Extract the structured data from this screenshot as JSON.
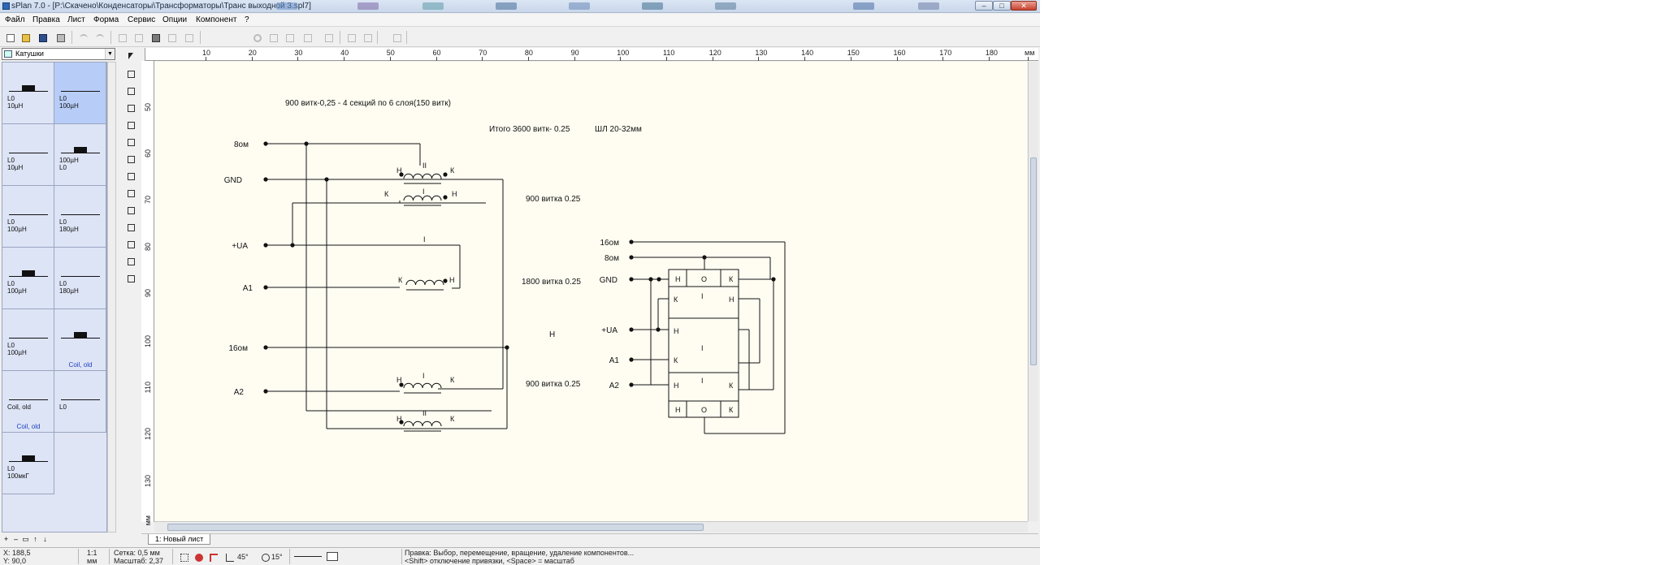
{
  "window": {
    "title": "sPlan 7.0 - [P:\\Скачено\\Конденсаторы\\Трансформаторы\\Транс выходной 3.spl7]",
    "buttons": {
      "minimize": "–",
      "maximize": "□",
      "close": "✕"
    }
  },
  "menu": [
    "Файл",
    "Правка",
    "Лист",
    "Форма",
    "Сервис",
    "Опции",
    "Компонент",
    "?"
  ],
  "toolbar": {
    "icons": [
      "new-file",
      "open-file",
      "save",
      "print",
      "undo",
      "redo",
      "cut",
      "copy",
      "paste",
      "duplicate",
      "delete",
      "rotate",
      "mirror-h",
      "mirror-v",
      "align",
      "group",
      "ungroup",
      "to-front",
      "to-back",
      "component-library",
      "find",
      "page-options",
      "zoom",
      "show-palette"
    ]
  },
  "palette": {
    "category": "Катушки",
    "cells": [
      {
        "label": "L0\n10µH",
        "caption": ""
      },
      {
        "label": "L0\n100µH",
        "caption": ""
      },
      {
        "label": "L0\n10µH",
        "caption": ""
      },
      {
        "label": "100µH\nL0",
        "caption": ""
      },
      {
        "label": "L0\n100µH",
        "caption": ""
      },
      {
        "label": "L0\n180µH",
        "caption": ""
      },
      {
        "label": "L0\n100µH",
        "caption": ""
      },
      {
        "label": "L0\n180µH",
        "caption": ""
      },
      {
        "label": "L0\n100µH",
        "caption": ""
      },
      {
        "label": "",
        "caption": "Coil, old"
      },
      {
        "label": "Coil, old",
        "caption": "Coil, old"
      },
      {
        "label": "L0",
        "caption": ""
      },
      {
        "label": "L0\n100мкГ",
        "caption": ""
      }
    ],
    "nav": [
      "+",
      "–",
      "▭",
      "↑",
      "↓"
    ]
  },
  "rulers": {
    "h": [
      "10",
      "20",
      "30",
      "40",
      "50",
      "60",
      "70",
      "80",
      "90",
      "100",
      "110",
      "120",
      "130",
      "140",
      "150",
      "160",
      "170",
      "180",
      "мм"
    ],
    "v": [
      "50",
      "60",
      "70",
      "80",
      "90",
      "100",
      "110",
      "120",
      "130",
      "мм"
    ]
  },
  "schematic": {
    "note1": "900 витк-0,25 - 4 секций по 6 слоя(150 витк)",
    "note2": "Итого 3600 витк- 0.25",
    "note3": "ШЛ 20-32мм",
    "terminals": [
      "8ом",
      "GND",
      "+UA",
      "A1",
      "16ом",
      "A2"
    ],
    "coil_labels": [
      "900 витка 0.25",
      "1800 витка 0.25",
      "Н",
      "900 витка 0.25"
    ],
    "roman": [
      "II",
      "I",
      "I",
      "I",
      "II"
    ],
    "HK": {
      "H": "Н",
      "K": "К",
      "O": "О",
      "I": "I"
    },
    "right_terminals": [
      "16ом",
      "8ом",
      "GND",
      "+UA",
      "A1",
      "A2"
    ]
  },
  "sheet_tab": "1: Новый лист",
  "status": {
    "x": "X: 188,5",
    "y": "Y: 90,0",
    "scale": "1:1",
    "unit": "мм",
    "grid": "Сетка: 0,5 мм",
    "zoom": "Масштаб: 2,37",
    "angle1": "45°",
    "angle2": "15°",
    "hint1": "Правка: Выбор, перемещение, вращение, удаление компонентов...",
    "hint2": "<Shift> отключение привязки, <Space> = масштаб"
  }
}
